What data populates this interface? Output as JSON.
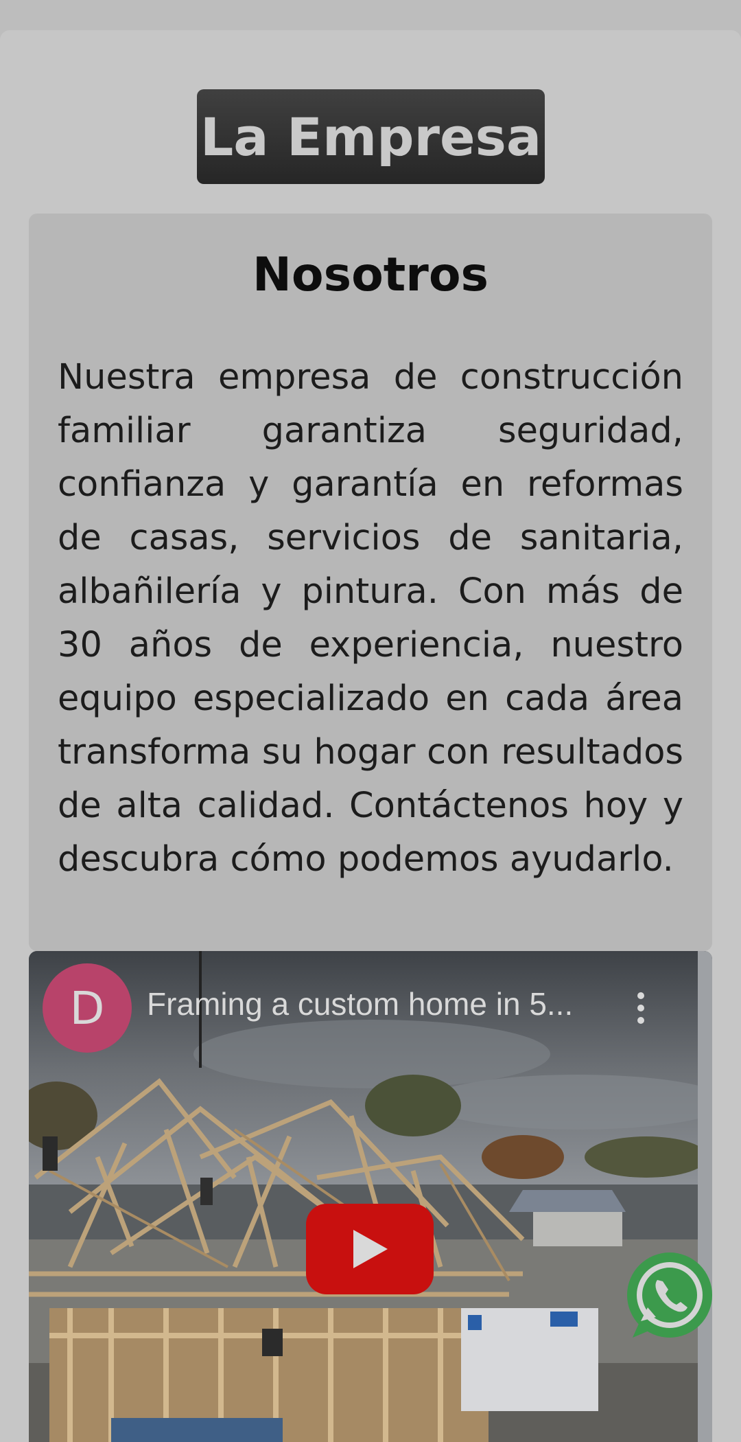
{
  "section": {
    "badge_title": "La Empresa"
  },
  "about": {
    "title": "Nosotros",
    "text": "Nuestra empresa de construcción familiar garantiza seguridad, confianza y garantía en reformas de casas, servicios de sanitaria, albañilería y pintura. Con más de 30 años de experiencia, nuestro equipo especializado en cada área transforma su hogar con resultados de alta calidad. Contáctenos hoy y descubra cómo podemos ayudarlo."
  },
  "video": {
    "channel_initial": "D",
    "title": "Framing a custom home in 5...",
    "play_icon": "youtube-play-icon",
    "menu_icon": "kebab-menu-icon"
  },
  "floating": {
    "whatsapp_icon": "whatsapp-icon"
  },
  "colors": {
    "play_red": "#c8100f",
    "avatar_pink": "#b8436a",
    "whatsapp_green": "#3c9a4c"
  }
}
